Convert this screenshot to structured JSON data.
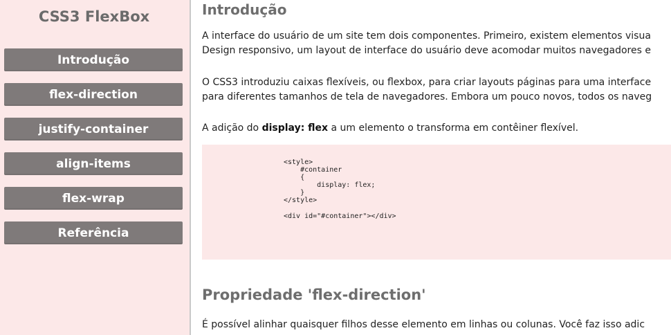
{
  "sidebar": {
    "title": "CSS3 FlexBox",
    "items": [
      {
        "label": "Introdução"
      },
      {
        "label": "flex-direction"
      },
      {
        "label": "justify-container"
      },
      {
        "label": "align-items"
      },
      {
        "label": "flex-wrap"
      },
      {
        "label": "Referência"
      }
    ]
  },
  "colors": {
    "sidebar_bg": "#fce8e8",
    "nav_button_bg": "#7f7a7a",
    "heading": "#6e6e6e",
    "code_bg": "#fce8e8"
  },
  "main": {
    "intro": {
      "heading": "Introdução",
      "p1_line1": "A interface do usuário de um site tem dois componentes. Primeiro, existem elementos visua",
      "p1_line2": "Design responsivo, um layout de interface do usuário deve acomodar muitos navegadores e",
      "p2_line1": "O CSS3 introduziu caixas flexíveis, ou flexbox, para criar layouts páginas para uma interface",
      "p2_line2": "para diferentes tamanhos de tela de navegadores. Embora um pouco novos, todos os naveg",
      "p3_before": "A adição do ",
      "p3_bold": "display: flex",
      "p3_after": " a um elemento o transforma em contêiner flexível."
    },
    "code": {
      "line1": "<style>",
      "line2": "    #container",
      "line3": "    {",
      "line4": "        display: flex;",
      "line5": "    }",
      "line6": "</style>",
      "line7": "<div id=\"#container\"></div>"
    },
    "flex_direction": {
      "heading": "Propriedade 'flex-direction'",
      "p1": "É possível alinhar quaisquer filhos desse elemento em linhas ou colunas. Você faz isso adic"
    }
  }
}
